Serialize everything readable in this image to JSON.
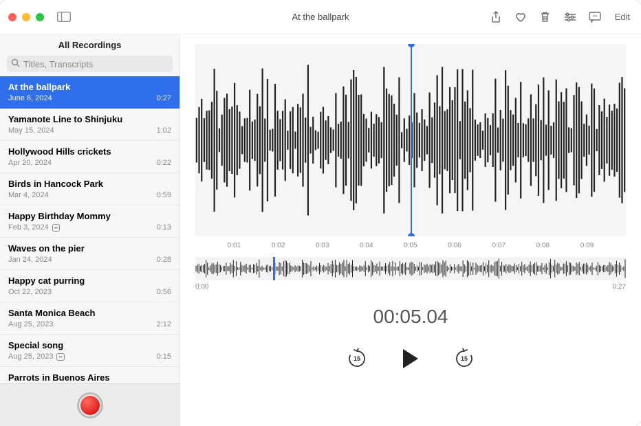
{
  "window": {
    "title": "At the ballpark"
  },
  "toolbar": {
    "edit_label": "Edit"
  },
  "sidebar": {
    "header": "All Recordings",
    "search_placeholder": "Titles, Transcripts",
    "items": [
      {
        "title": "At the ballpark",
        "date": "June 8, 2024",
        "duration": "0:27",
        "selected": true,
        "transcript": false
      },
      {
        "title": "Yamanote Line to Shinjuku",
        "date": "May 15, 2024",
        "duration": "1:02",
        "selected": false,
        "transcript": false
      },
      {
        "title": "Hollywood Hills crickets",
        "date": "Apr 20, 2024",
        "duration": "0:22",
        "selected": false,
        "transcript": false
      },
      {
        "title": "Birds in Hancock Park",
        "date": "Mar 4, 2024",
        "duration": "0:59",
        "selected": false,
        "transcript": false
      },
      {
        "title": "Happy Birthday Mommy",
        "date": "Feb 3, 2024",
        "duration": "0:13",
        "selected": false,
        "transcript": true
      },
      {
        "title": "Waves on the pier",
        "date": "Jan 24, 2024",
        "duration": "0:28",
        "selected": false,
        "transcript": false
      },
      {
        "title": "Happy cat purring",
        "date": "Oct 22, 2023",
        "duration": "0:56",
        "selected": false,
        "transcript": false
      },
      {
        "title": "Santa Monica Beach",
        "date": "Aug 25, 2023",
        "duration": "2:12",
        "selected": false,
        "transcript": false
      },
      {
        "title": "Special song",
        "date": "Aug 25, 2023",
        "duration": "0:15",
        "selected": false,
        "transcript": true
      },
      {
        "title": "Parrots in Buenos Aires",
        "date": "",
        "duration": "",
        "selected": false,
        "transcript": false
      }
    ]
  },
  "timeline": {
    "ticks": [
      "",
      "0:01",
      "0:02",
      "0:03",
      "0:04",
      "0:05",
      "0:06",
      "0:07",
      "0:08",
      "0:09",
      ""
    ],
    "start": "0:00",
    "end": "0:27",
    "playhead_percent": 50,
    "overview_playhead_percent": 18
  },
  "counter": "00:05.04",
  "skip_seconds": "15",
  "colors": {
    "accent": "#2f6fec"
  }
}
